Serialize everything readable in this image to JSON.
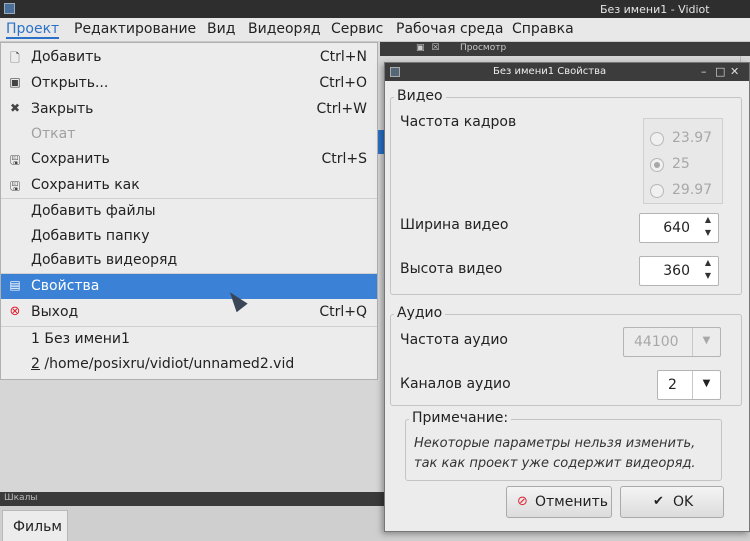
{
  "app": {
    "title": "Без имени1 - Vidiot"
  },
  "menubar": [
    "Проект",
    "Редактирование",
    "Вид",
    "Видеоряд",
    "Сервис",
    "Рабочая среда",
    "Справка"
  ],
  "background": {
    "preview_label": "Просмотр",
    "timeline_label": "Шкалы",
    "tab_film": "Фильм"
  },
  "project_menu": {
    "add": {
      "label": "Добавить",
      "shortcut": "Ctrl+N"
    },
    "open": {
      "label": "Открыть...",
      "shortcut": "Ctrl+O"
    },
    "close": {
      "label": "Закрыть",
      "shortcut": "Ctrl+W"
    },
    "revert": {
      "label": "Откат"
    },
    "save": {
      "label": "Сохранить",
      "shortcut": "Ctrl+S"
    },
    "save_as": {
      "label": "Сохранить как"
    },
    "add_files": {
      "label": "Добавить файлы"
    },
    "add_folder": {
      "label": "Добавить папку"
    },
    "add_sequence": {
      "label": "Добавить видеоряд"
    },
    "properties": {
      "label": "Свойства"
    },
    "exit": {
      "label": "Выход",
      "shortcut": "Ctrl+Q"
    },
    "recent1": {
      "label": "1 Без имени1"
    },
    "recent2_num": "2",
    "recent2_path": " /home/posixru/vidiot/unnamed2.vid"
  },
  "dialog": {
    "title": "Без имени1 Свойства",
    "video_group": "Видео",
    "frame_rate_label": "Частота кадров",
    "frame_rates": [
      "23.97",
      "25",
      "29.97"
    ],
    "frame_rate_selected": "25",
    "width_label": "Ширина видео",
    "width_value": "640",
    "height_label": "Высота видео",
    "height_value": "360",
    "audio_group": "Аудио",
    "audio_rate_label": "Частота аудио",
    "audio_rate_value": "44100",
    "channels_label": "Каналов аудио",
    "channels_value": "2",
    "note_title": "Примечание:",
    "note_text": "Некоторые параметры нельзя изменить, так как проект уже содержит видеоряд.",
    "cancel_label": "Отменить",
    "ok_label": "OK"
  },
  "colors": {
    "accent": "#3b82d6",
    "exit_icon": "#d23333"
  }
}
